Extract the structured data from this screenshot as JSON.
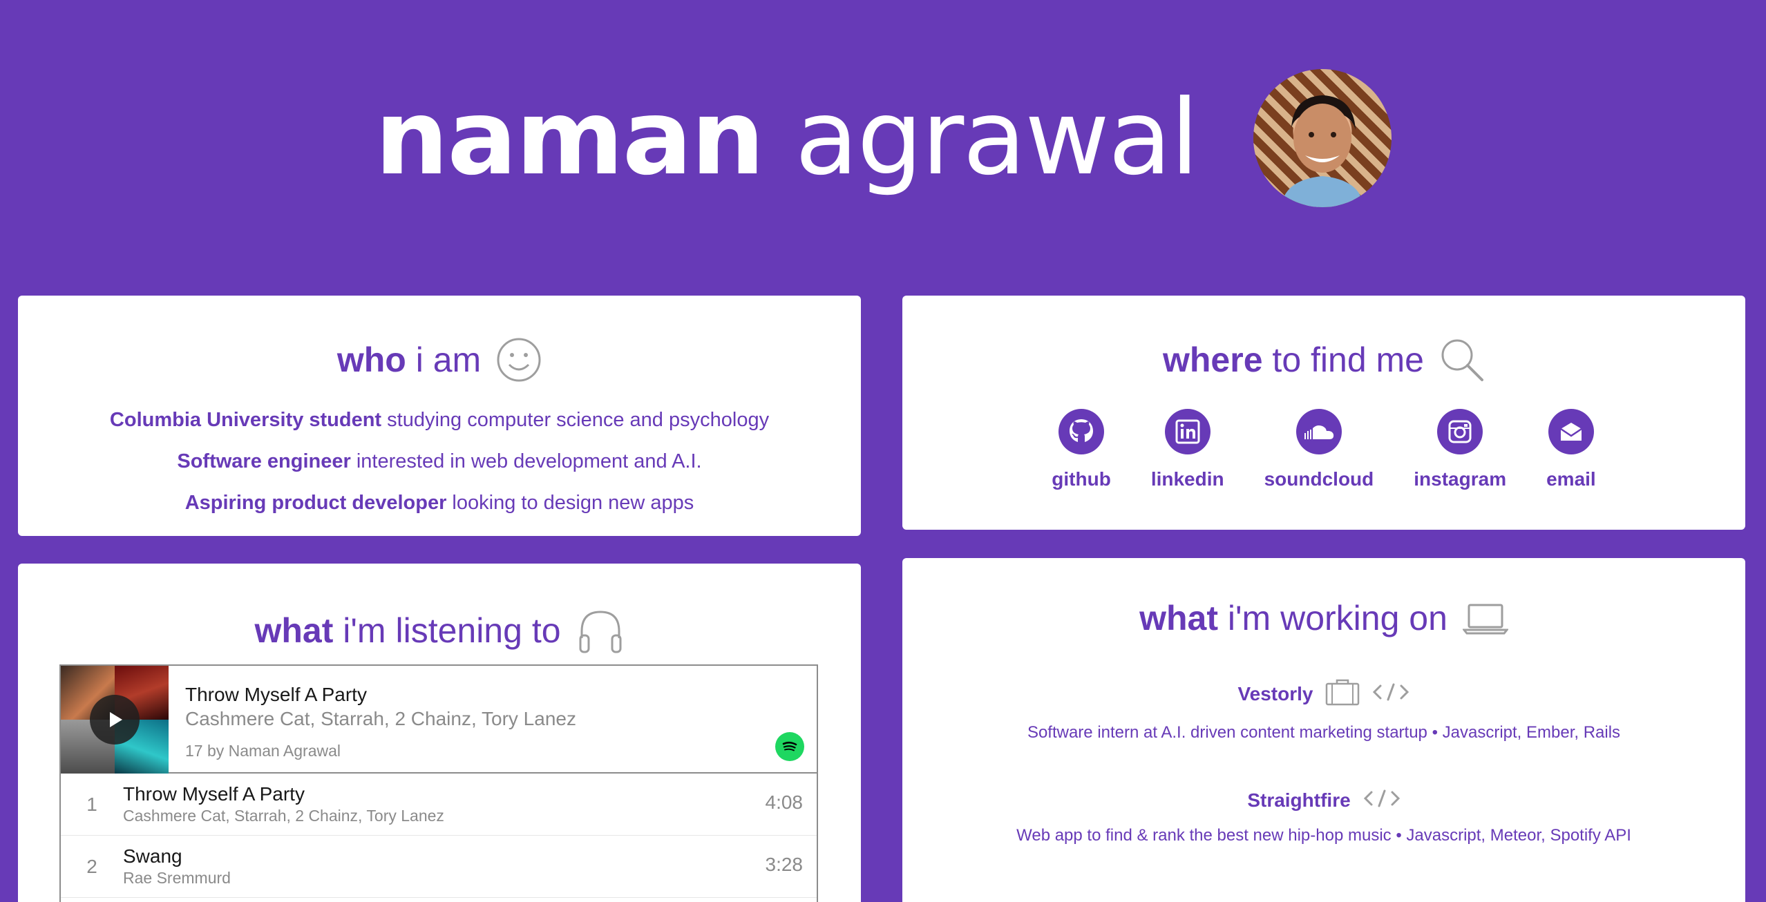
{
  "header": {
    "first_name": "naman",
    "last_name": "agrawal"
  },
  "who": {
    "title_kw": "who",
    "title_rest": "i am",
    "icon": "smiley-icon",
    "lines": [
      {
        "bold": "Columbia University student",
        "text": " studying computer science and psychology"
      },
      {
        "bold": "Software engineer",
        "text": " interested in web development and A.I."
      },
      {
        "bold": "Aspiring product developer",
        "text": " looking to design new apps"
      }
    ]
  },
  "where": {
    "title_kw": "where",
    "title_rest": "to find me",
    "icon": "magnifier-icon",
    "links": [
      {
        "label": "github",
        "icon": "github-icon"
      },
      {
        "label": "linkedin",
        "icon": "linkedin-icon"
      },
      {
        "label": "soundcloud",
        "icon": "soundcloud-icon"
      },
      {
        "label": "instagram",
        "icon": "instagram-icon"
      },
      {
        "label": "email",
        "icon": "email-icon"
      }
    ]
  },
  "listening": {
    "title_kw": "what",
    "title_rest": "i'm listening to",
    "icon": "headphones-icon",
    "player": {
      "title": "Throw Myself A Party",
      "artists": "Cashmere Cat, Starrah, 2 Chainz, Tory Lanez",
      "owner": "17 by Naman Agrawal"
    },
    "tracks": [
      {
        "num": "1",
        "title": "Throw Myself A Party",
        "artists": "Cashmere Cat, Starrah, 2 Chainz, Tory Lanez",
        "duration": "4:08"
      },
      {
        "num": "2",
        "title": "Swang",
        "artists": "Rae Sremmurd",
        "duration": "3:28"
      }
    ]
  },
  "working": {
    "title_kw": "what",
    "title_rest": "i'm working on",
    "icon": "laptop-icon",
    "projects": [
      {
        "name": "Vestorly",
        "desc": "Software intern at A.I. driven content marketing startup • Javascript, Ember, Rails",
        "icons": [
          "briefcase-icon",
          "code-icon"
        ]
      },
      {
        "name": "Straightfire",
        "desc": "Web app to find & rank the best new hip-hop music • Javascript, Meteor, Spotify API",
        "icons": [
          "code-icon"
        ]
      }
    ]
  },
  "colors": {
    "brand": "#673ab7",
    "card": "#ffffff",
    "spotify": "#1ed760"
  }
}
